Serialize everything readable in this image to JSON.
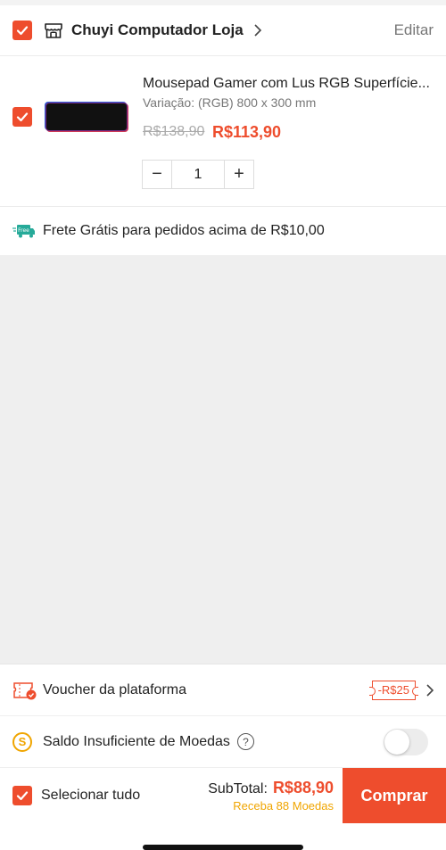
{
  "shop": {
    "name": "Chuyi Computador Loja",
    "edit_label": "Editar"
  },
  "item": {
    "title": "Mousepad Gamer com Lus RGB Superfície...",
    "variation": "Variação: (RGB) 800 x 300 mm",
    "old_price": "R$138,90",
    "price": "R$113,90",
    "quantity": "1",
    "minus": "−",
    "plus": "+"
  },
  "shipping": {
    "icon_text": "Free",
    "text": "Frete Grátis para pedidos acima de R$10,00"
  },
  "voucher": {
    "label": "Voucher da plataforma",
    "tag": "-R$25"
  },
  "coins": {
    "icon_text": "S",
    "label": "Saldo Insuficiente de Moedas",
    "help": "?",
    "toggle_on": false
  },
  "checkout": {
    "select_all": "Selecionar tudo",
    "subtotal_label": "SubTotal:",
    "subtotal_value": "R$88,90",
    "coins_earn": "Receba 88 Moedas",
    "buy_label": "Comprar"
  },
  "colors": {
    "accent": "#ee4d2d",
    "coin": "#f0a500",
    "free_shipping": "#26aa99"
  }
}
